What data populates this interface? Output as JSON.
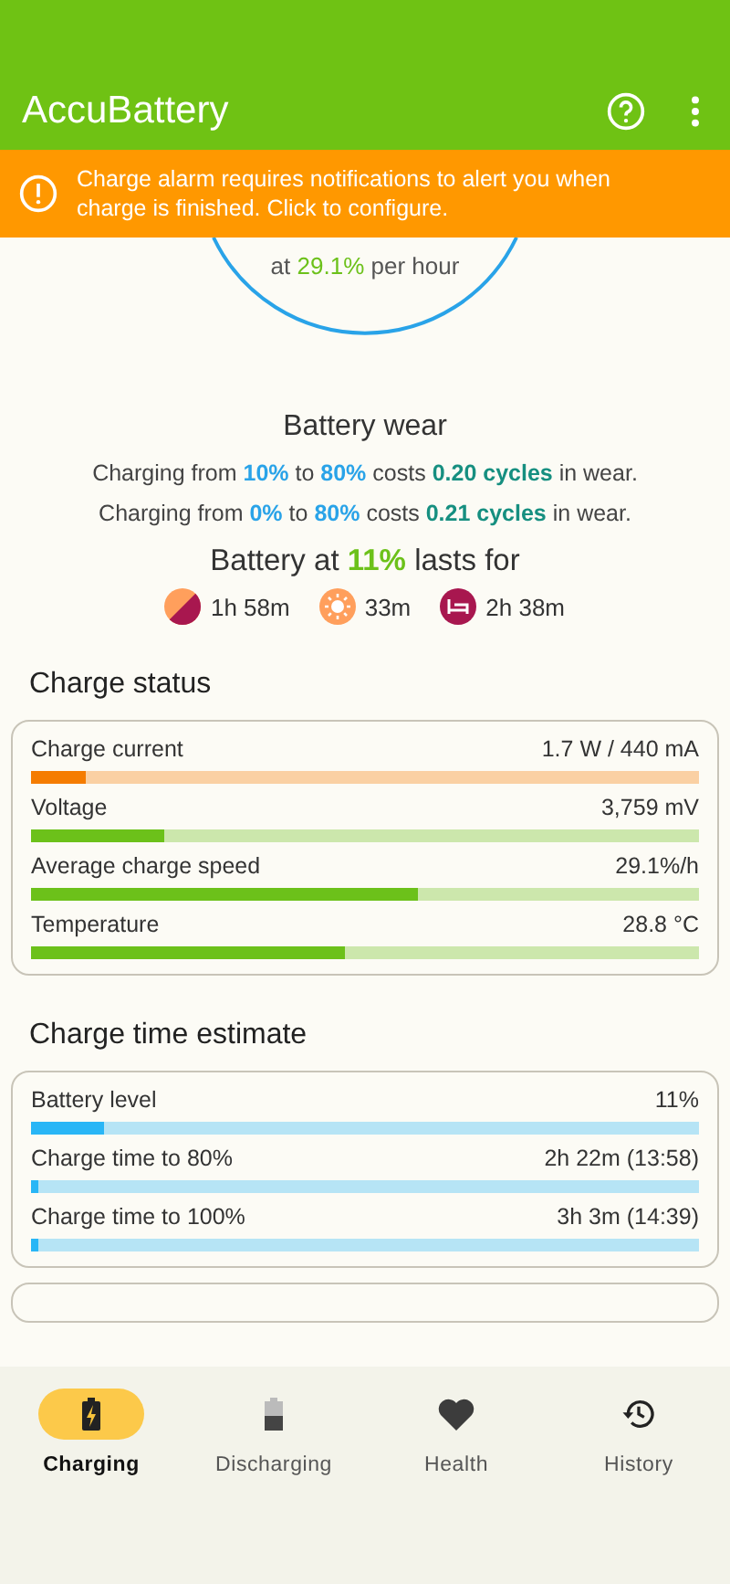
{
  "app_bar": {
    "title": "AccuBattery"
  },
  "banner": {
    "text": "Charge alarm requires notifications to alert you when charge is finished. Click to configure."
  },
  "gauge": {
    "line_2": "at **29.1%** per hour"
  },
  "battery_wear": {
    "title": "Battery wear",
    "lines": [
      "Charging from **10%** to **80%** costs **0.20 cycles** in wear.",
      "Charging from **0%** to **80%** costs **0.21 cycles** in wear."
    ]
  },
  "lasts": {
    "title": "Battery at **11%** lasts for",
    "items": [
      {
        "kind": "mixed",
        "value": "1h 58m"
      },
      {
        "kind": "screen_on",
        "value": "33m"
      },
      {
        "kind": "sleep",
        "value": "2h 38m"
      }
    ]
  },
  "charge_status": {
    "title": "Charge status",
    "rows": [
      {
        "label": "Charge current",
        "value": "1.7 W / 440 mA",
        "level": 0.083,
        "color": "#f57c00"
      },
      {
        "label": "Voltage",
        "value": "3,759 mV",
        "level": 0.2,
        "color": "#6cc11a"
      },
      {
        "label": "Average charge speed",
        "value": "29.1%/h",
        "level": 0.58,
        "color": "#6cc11a"
      },
      {
        "label": "Temperature",
        "value": "28.8 °C",
        "level": 0.47,
        "color": "#6cc11a"
      }
    ]
  },
  "charge_time": {
    "title": "Charge time estimate",
    "rows": [
      {
        "label": "Battery level",
        "value": "11%",
        "level": 0.11,
        "color": "#29b6f6"
      },
      {
        "label": "Charge time to 80%",
        "value": "2h 22m (13:58)",
        "level": 0.012,
        "color": "#29b6f6"
      },
      {
        "label": "Charge time to 100%",
        "value": "3h 3m (14:39)",
        "level": 0.012,
        "color": "#29b6f6"
      }
    ]
  },
  "bottom_nav": [
    {
      "label": "Charging",
      "kind": "charging",
      "selected": true
    },
    {
      "label": "Discharging",
      "kind": "discharging",
      "selected": false
    },
    {
      "label": "Health",
      "kind": "health",
      "selected": false
    },
    {
      "label": "History",
      "kind": "history",
      "selected": false
    }
  ]
}
